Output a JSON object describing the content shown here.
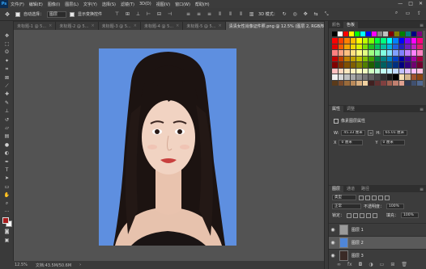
{
  "app": {
    "logo": "Ps"
  },
  "menubar": {
    "items": [
      "文件(F)",
      "编辑(E)",
      "图像(I)",
      "图层(L)",
      "文字(Y)",
      "选择(S)",
      "滤镜(T)",
      "3D(D)",
      "视图(V)",
      "窗口(W)",
      "帮助(H)"
    ]
  },
  "window_controls": {
    "minimize": "—",
    "maximize": "□",
    "close": "✕"
  },
  "options_bar": {
    "auto_select_label": "自动选择：",
    "auto_select_value": "图层",
    "show_transform_label": "显示变换控件",
    "mode_3d_label": "3D 模式："
  },
  "tabs": [
    {
      "label": "未标题-1 @ 5...",
      "active": false
    },
    {
      "label": "未标题-2 @ 5...",
      "active": false
    },
    {
      "label": "未标题-3 @ 5...",
      "active": false
    },
    {
      "label": "未标题-4 @ 5...",
      "active": false
    },
    {
      "label": "未标题-5 @ 5...",
      "active": false
    },
    {
      "label": "清清女性肖像证件照.png @ 12.5% (图层 2, RGB/8) *",
      "active": true
    }
  ],
  "tab_close": "×",
  "tab_overflow": "»",
  "status": {
    "zoom": "12.5%",
    "doc_size": "文档:43.5M/50.6M",
    "arrow": "›"
  },
  "swatches_panel": {
    "tabs": [
      "颜色",
      "色板"
    ],
    "active_tab": "色板",
    "menu": "≡"
  },
  "properties_panel": {
    "tabs": [
      "属性",
      "调整"
    ],
    "subtitle": "像素图层属性",
    "w_label": "W:",
    "w_value": "45.33 厘米",
    "link": "∞",
    "h_label": "H:",
    "h_value": "65.01 厘米",
    "x_label": "X",
    "x_value": "0 厘米",
    "y_label": "Y",
    "y_value": "0 厘米"
  },
  "layers_panel": {
    "tabs": [
      "图层",
      "通道",
      "路径"
    ],
    "filter_kind": "类型",
    "blend_mode": "正常",
    "opacity_label": "不透明度：",
    "opacity_value": "100%",
    "lock_label": "锁定：",
    "fill_label": "填充：",
    "fill_value": "100%",
    "layers": [
      {
        "name": "图层 1",
        "selected": false,
        "thumb": "#9a9a9a"
      },
      {
        "name": "图层 2",
        "selected": true,
        "thumb": "#4f86d8"
      },
      {
        "name": "图层 3",
        "selected": false,
        "thumb": "#3a2a26"
      }
    ]
  },
  "colors": {
    "foreground": "#a81d1d",
    "background": "#ffffff",
    "photo_background": "#5e8fe0",
    "ps_accent": "#31a8ff"
  }
}
